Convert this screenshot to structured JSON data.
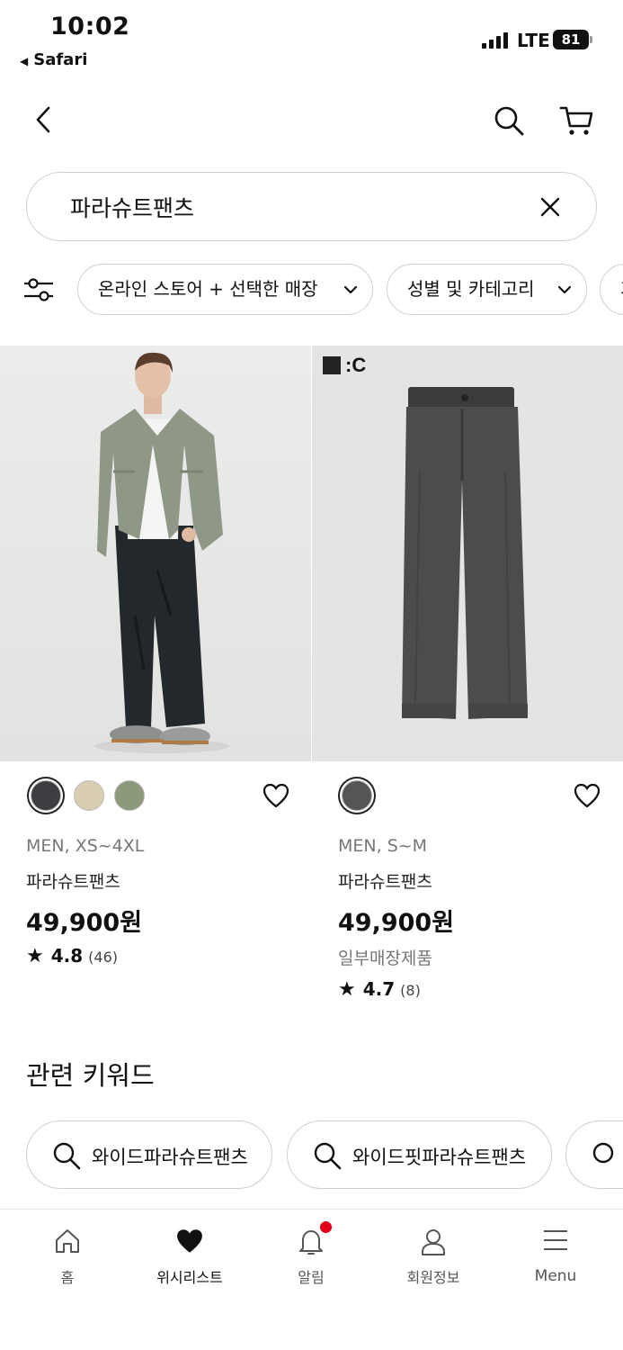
{
  "status_bar": {
    "time": "10:02",
    "back_app": "Safari",
    "network": "LTE",
    "battery": "81"
  },
  "header": {
    "icons": [
      "back-chevron-icon",
      "search-icon",
      "cart-icon"
    ]
  },
  "search": {
    "query": "파라슈트팬츠",
    "clear_icon": "close-icon"
  },
  "filters": {
    "icon": "sliders-icon",
    "chips": [
      {
        "label": "온라인 스토어 + 선택한 매장"
      },
      {
        "label": "성별 및 카테고리"
      },
      {
        "label": "가"
      }
    ]
  },
  "products": [
    {
      "colors": [
        "#3c3e42",
        "#d8cdb0",
        "#8c9a7a"
      ],
      "meta": "MEN, XS~4XL",
      "name": "파라슈트팬츠",
      "price": "49,900원",
      "rating": "4.8",
      "reviews": "(46)"
    },
    {
      "badge": "UNI QLO :C",
      "colors": [
        "#555558"
      ],
      "meta": "MEN, S~M",
      "name": "파라슈트팬츠",
      "price": "49,900원",
      "stock": "일부매장제품",
      "rating": "4.7",
      "reviews": "(8)"
    }
  ],
  "keywords": {
    "title": "관련 키워드",
    "items": [
      "와이드파라슈트팬츠",
      "와이드핏파라슈트팬츠",
      ""
    ]
  },
  "bottom_nav": [
    {
      "label": "홈",
      "icon": "home-icon"
    },
    {
      "label": "위시리스트",
      "icon": "heart-filled-icon",
      "active": true
    },
    {
      "label": "알림",
      "icon": "bell-icon",
      "badge": true
    },
    {
      "label": "회원정보",
      "icon": "user-icon"
    },
    {
      "label": "Menu",
      "icon": "menu-icon"
    }
  ],
  "colors": {
    "accent_red": "#e0001a",
    "border": "#cfcfcf"
  }
}
